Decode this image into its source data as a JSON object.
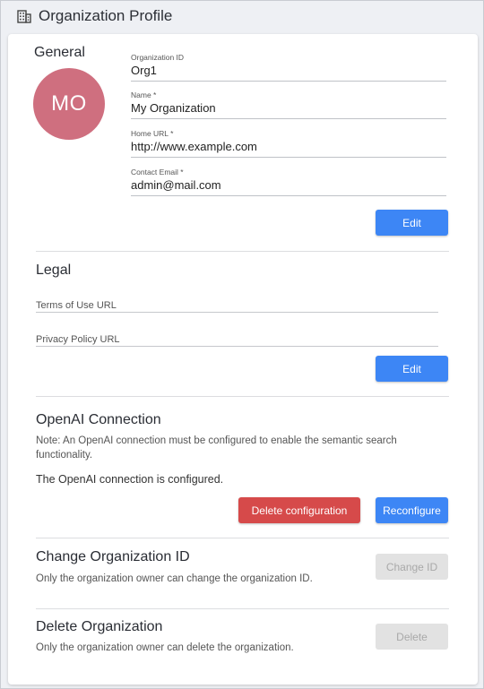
{
  "header": {
    "title": "Organization Profile",
    "icon": "building-icon"
  },
  "general": {
    "title": "General",
    "avatar_initials": "MO",
    "avatar_color": "#cf6f7f",
    "fields": [
      {
        "label": "Organization ID",
        "value": "Org1"
      },
      {
        "label": "Name *",
        "value": "My Organization"
      },
      {
        "label": "Home URL *",
        "value": "http://www.example.com"
      },
      {
        "label": "Contact Email *",
        "value": "admin@mail.com"
      }
    ],
    "edit_label": "Edit"
  },
  "legal": {
    "title": "Legal",
    "terms_label": "Terms of Use URL",
    "terms_value": "",
    "privacy_label": "Privacy Policy URL",
    "privacy_value": "",
    "edit_label": "Edit"
  },
  "openai": {
    "title": "OpenAI Connection",
    "note": "Note: An OpenAI connection must be configured to enable the semantic search functionality.",
    "status": "The OpenAI connection is configured.",
    "delete_label": "Delete configuration",
    "reconfigure_label": "Reconfigure"
  },
  "change_id": {
    "title": "Change Organization ID",
    "note": "Only the organization owner can change the organization ID.",
    "button_label": "Change ID"
  },
  "delete_org": {
    "title": "Delete Organization",
    "note": "Only the organization owner can delete the organization.",
    "button_label": "Delete"
  },
  "colors": {
    "primary": "#3d86f5",
    "danger": "#d64a4a",
    "disabled": "#e2e2e2"
  }
}
